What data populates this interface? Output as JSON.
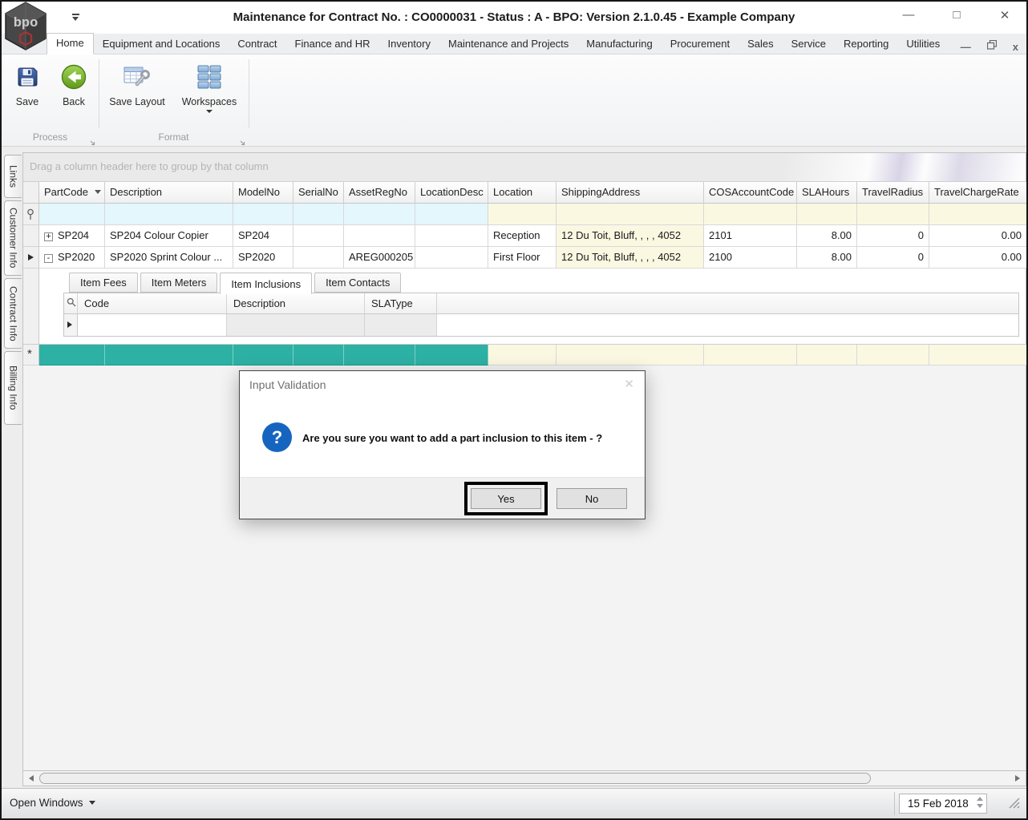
{
  "window": {
    "title": "Maintenance for Contract No. : CO0000031 - Status : A - BPO: Version 2.1.0.45 - Example Company",
    "logo_text": "bpo"
  },
  "icons": {
    "minimize": "—",
    "maximize": "□",
    "close": "✕",
    "child_minimize": "—",
    "child_close": "x",
    "dialog_question": "?",
    "dialog_close": "✕"
  },
  "ribbon": {
    "tabs": [
      {
        "label": "Home",
        "active": true
      },
      {
        "label": "Equipment and Locations"
      },
      {
        "label": "Contract"
      },
      {
        "label": "Finance and HR"
      },
      {
        "label": "Inventory"
      },
      {
        "label": "Maintenance and Projects"
      },
      {
        "label": "Manufacturing"
      },
      {
        "label": "Procurement"
      },
      {
        "label": "Sales"
      },
      {
        "label": "Service"
      },
      {
        "label": "Reporting"
      },
      {
        "label": "Utilities"
      }
    ],
    "buttons": {
      "save": "Save",
      "back": "Back",
      "save_layout": "Save Layout",
      "workspaces": "Workspaces"
    },
    "groups": [
      {
        "label": "Process"
      },
      {
        "label": "Format"
      }
    ]
  },
  "sidebar": {
    "items": [
      {
        "label": "Links"
      },
      {
        "label": "Customer Info"
      },
      {
        "label": "Contract Info"
      },
      {
        "label": "Billing Info"
      }
    ]
  },
  "grid": {
    "group_panel_text": "Drag a column header here to group by that column",
    "columns": [
      {
        "label": "PartCode"
      },
      {
        "label": "Description"
      },
      {
        "label": "ModelNo"
      },
      {
        "label": "SerialNo"
      },
      {
        "label": "AssetRegNo"
      },
      {
        "label": "LocationDesc"
      },
      {
        "label": "Location"
      },
      {
        "label": "ShippingAddress"
      },
      {
        "label": "COSAccountCode"
      },
      {
        "label": "SLAHours"
      },
      {
        "label": "TravelRadius"
      },
      {
        "label": "TravelChargeRate"
      }
    ],
    "rows": [
      {
        "expand": "+",
        "part_code": "SP204",
        "description": "SP204 Colour Copier",
        "model_no": "SP204",
        "serial_no": "",
        "asset_reg_no": "",
        "location_desc": "",
        "location": "Reception",
        "shipping_address": "12 Du Toit, Bluff, , , , 4052",
        "cos_account_code": "2101",
        "sla_hours": "8.00",
        "travel_radius": "0",
        "travel_charge_rate": "0.00"
      },
      {
        "expand": "-",
        "part_code": "SP2020",
        "description": "SP2020 Sprint Colour ...",
        "model_no": "SP2020",
        "serial_no": "",
        "asset_reg_no": "AREG000205",
        "location_desc": "",
        "location": "First Floor",
        "shipping_address": "12 Du Toit, Bluff, , , , 4052",
        "cos_account_code": "2100",
        "sla_hours": "8.00",
        "travel_radius": "0",
        "travel_charge_rate": "0.00"
      }
    ],
    "new_row_marker": "*"
  },
  "detail": {
    "tabs": [
      {
        "label": "Item Fees"
      },
      {
        "label": "Item Meters"
      },
      {
        "label": "Item Inclusions",
        "active": true
      },
      {
        "label": "Item Contacts"
      }
    ],
    "columns": [
      {
        "label": "Code"
      },
      {
        "label": "Description"
      },
      {
        "label": "SLAType"
      }
    ]
  },
  "dialog": {
    "title": "Input Validation",
    "message": "Are you sure you want to add a part inclusion to this item - ?",
    "yes_label": "Yes",
    "no_label": "No"
  },
  "statusbar": {
    "open_windows_label": "Open Windows",
    "date_value": "15 Feb 2018"
  },
  "colors": {
    "new_row_teal": "#2db1a4",
    "cell_pale_yellow": "#fbf8e2",
    "filter_cyan": "#e3f7fc",
    "dialog_icon_blue": "#1565c0",
    "back_button_green": "#79b928"
  }
}
